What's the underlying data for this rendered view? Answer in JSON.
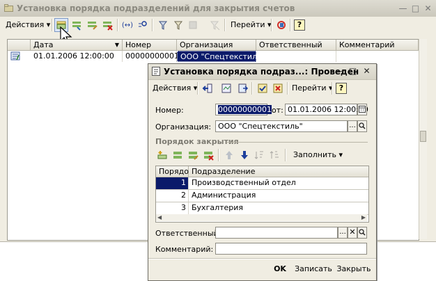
{
  "main_window": {
    "title": "Установка порядка подразделений для закрытия счетов",
    "toolbar": {
      "actions_label": "Действия",
      "goto_label": "Перейти",
      "help_label": "?"
    },
    "columns": [
      "Дата",
      "Номер",
      "Организация",
      "Ответственный",
      "Комментарий"
    ],
    "rows": [
      {
        "date": "01.01.2006 12:00:00",
        "number": "00000000001",
        "org": "ООО \"Спецтекстиль\"",
        "resp": "",
        "comment": ""
      }
    ]
  },
  "dialog": {
    "title": "Установка порядка подраз...: Проведен",
    "toolbar": {
      "actions_label": "Действия",
      "goto_label": "Перейти",
      "help_label": "?"
    },
    "number_label": "Номер:",
    "number_value": "00000000001",
    "date_label": "от:",
    "date_value": "01.01.2006 12:00:00",
    "org_label": "Организация:",
    "org_value": "ООО \"Спецтекстиль\"",
    "section_title": "Порядок закрытия",
    "fill_label": "Заполнить",
    "table": {
      "columns": [
        "Порядок",
        "Подразделение"
      ],
      "rows": [
        {
          "order": "1",
          "dept": "Производственный отдел"
        },
        {
          "order": "2",
          "dept": "Администрация"
        },
        {
          "order": "3",
          "dept": "Бухгалтерия"
        }
      ]
    },
    "responsible_label": "Ответственный:",
    "responsible_value": "",
    "comment_label": "Комментарий:",
    "comment_value": "",
    "ok_label": "OK",
    "save_label": "Записать",
    "close_label": "Закрыть"
  },
  "colors": {
    "selection": "#0a1a6a",
    "title_inactive": "#8c8a80",
    "panel": "#f0ede2"
  }
}
